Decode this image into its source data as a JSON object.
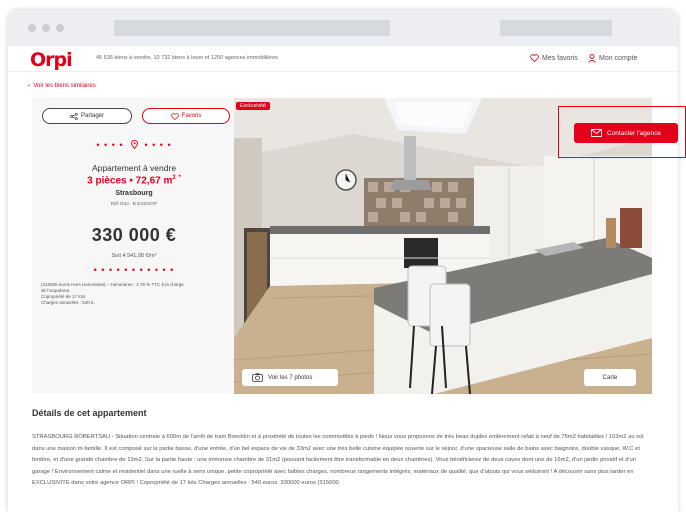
{
  "header": {
    "logo": "Orpi",
    "tagline": "45 536 biens à vendre, 10 732 biens à louer et 1250 agences immobilières",
    "favorites_label": "Mes favoris",
    "account_label": "Mon compte"
  },
  "nav": {
    "back_label": "Voir les biens similaires"
  },
  "listing": {
    "share_label": "Partager",
    "favorite_label": "Favoris",
    "property_type": "Appartement à vendre",
    "rooms_area": "3 pièces • 72,67 m",
    "area_unit_sup": "2",
    "rooms_area_suffix": "*",
    "city": "Strasbourg",
    "reference": "Réf Orpi : B-E1EGOP",
    "price": "330 000 €",
    "price_per_sqm": "Soit 4 541,08 €/m²",
    "fees_line1": "(315000 euros Hors Honoraires) – Honoraires : 4.76 % TTC à la charge",
    "fees_line2": "de l'acquéreur.",
    "fees_line3": "Copropriété de 17 lots",
    "fees_line4": "Charges annuelles : 540 €."
  },
  "photo": {
    "badge": "Exclusivité",
    "photos_button": "Voir les 7 photos",
    "map_button": "Carte"
  },
  "contact": {
    "label": "Contacter l'agence"
  },
  "details": {
    "title": "Détails de cet appartement",
    "text": "STRASBOURG ROBERTSAU - Situation centrale à 600m de l'arrêt de tram Boecklin et à proximité de toutes les commodités à pieds ! Nous vous proposons de très beau duplex entièrement refait à neuf de 75m2 habitables / 103m2 au sol dans une maison tri-famille. Il est composé sur la partie basse, d'une entrée, d'un bel espace de vie de 33m2 avec une très belle cuisine équipée ouverte sur le séjour, d'une spacieuse salle de bains avec baignoire, double vasque, W.C et fenêtre, et d'une grande chambre de 13m2. Sur la partie haute : une immense chambre de 31m2 (pouvant facilement être transformable en deux chambres). Vous bénéficierez de deux caves dont une de 16m2, d'un jardin privatif et d'un garage ! Environnement calme et résidentiel dans une ruelle à sens unique, petite copropriété avec faibles charges, nombreux rangements intégrés, matériaux de qualité, que d'atouts qui vous séduiront ! A découvrir sans plus tarder en EXCLUSIVITE dans votre agence ORPI ! Copropriété de 17 lots Charges annuelles : 540 euros. 330000 euros (315000"
  },
  "colors": {
    "brand": "#e3001b",
    "card_bg": "#f7f7f7",
    "chrome_bg": "#eceef1"
  },
  "icons": [
    "share-icon",
    "heart-icon",
    "location-pin-icon",
    "user-icon",
    "camera-icon",
    "envelope-icon",
    "chevron-left-icon"
  ]
}
